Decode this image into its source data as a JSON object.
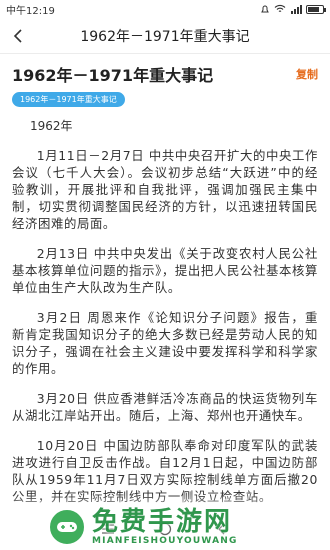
{
  "status_bar": {
    "time": "中午12:19",
    "battery_level": 0.7
  },
  "nav": {
    "title": "1962年－1971年重大事记"
  },
  "article": {
    "title": "1962年－1971年重大事记",
    "copy_label": "复制",
    "tag": "1962年－1971年重大事记",
    "year": "1962年",
    "paragraphs": [
      "1月11日－2月7日 中共中央召开扩大的中央工作会议（七千人大会）。会议初步总结“大跃进”中的经验教训，开展批评和自我批评，强调加强民主集中制，切实贯彻调整国民经济的方针，以迅速扭转国民经济困难的局面。",
      "2月13日 中共中央发出《关于改变农村人民公社基本核算单位问题的指示》，提出把人民公社基本核算单位由生产大队改为生产队。",
      "3月2日 周恩来作《论知识分子问题》报告，重新肯定我国知识分子的绝大多数已经是劳动人民的知识分子，强调在社会主义建设中要发挥科学和科学家的作用。",
      "3月20日 供应香港鲜活冷冻商品的快运货物列车从湖北江岸站开出。随后，上海、郑州也开通快车。",
      "10月20日 中国边防部队奉命对印度军队的武装进攻进行自卫反击作战。自12月1日起，中国边防部队从1959年11月7日双方实际控制线单方面后撤20公里，并在实际控制线中方一侧设立检查站。"
    ]
  },
  "watermark": {
    "cn": "免费手游网",
    "en": "MIANFEISHOUYOUWANG"
  },
  "colors": {
    "accent": "#e66b1c",
    "tag_bg": "#3fa9e8",
    "watermark": "#1f8f3e"
  }
}
